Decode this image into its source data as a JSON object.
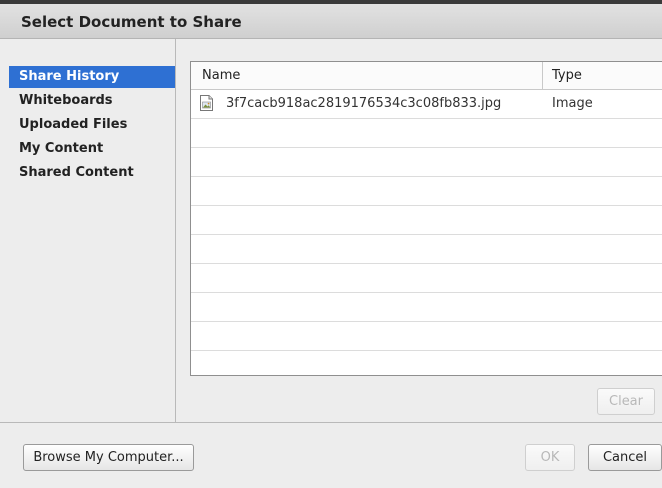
{
  "dialog": {
    "title": "Select Document to Share"
  },
  "sidebar": {
    "items": [
      {
        "label": "Share History",
        "selected": true
      },
      {
        "label": "Whiteboards",
        "selected": false
      },
      {
        "label": "Uploaded Files",
        "selected": false
      },
      {
        "label": "My Content",
        "selected": false
      },
      {
        "label": "Shared Content",
        "selected": false
      }
    ]
  },
  "file_list": {
    "columns": {
      "name": "Name",
      "type": "Type"
    },
    "rows": [
      {
        "name": "3f7cacb918ac2819176534c3c08fb833.jpg",
        "type": "Image",
        "icon": "image-file-icon"
      }
    ]
  },
  "buttons": {
    "clear": "Clear",
    "browse": "Browse My Computer...",
    "ok": "OK",
    "cancel": "Cancel"
  },
  "colors": {
    "selection": "#2e70d3"
  }
}
